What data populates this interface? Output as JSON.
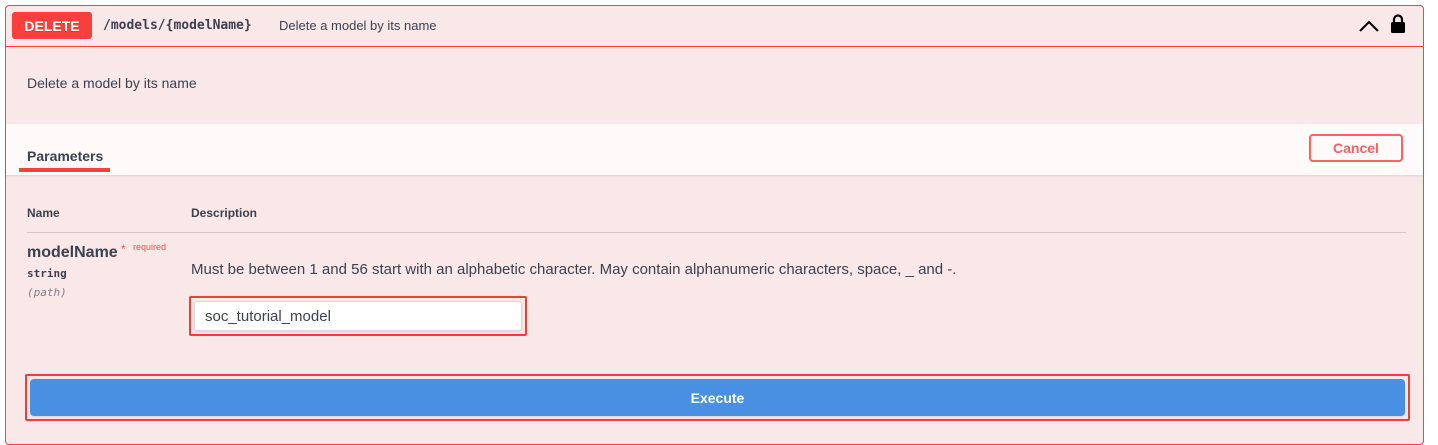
{
  "summary": {
    "method": "DELETE",
    "path": "/models/{modelName}",
    "description": "Delete a model by its name"
  },
  "description": "Delete a model by its name",
  "tabs": {
    "parameters": "Parameters"
  },
  "buttons": {
    "cancel": "Cancel",
    "execute": "Execute"
  },
  "table": {
    "headers": [
      "Name",
      "Description"
    ],
    "rows": [
      {
        "name": "modelName",
        "required_star": "*",
        "required_label": "required",
        "type": "string",
        "in": "(path)",
        "description": "Must be between 1 and 56 start with an alphabetic character. May contain alphanumeric characters, space, _ and -.",
        "value": "soc_tutorial_model"
      }
    ]
  },
  "icons": {
    "collapse": "chevron-up-icon",
    "auth": "lock-icon"
  },
  "colors": {
    "delete": "#f93e3e",
    "block_bg": "#fae7e7",
    "execute": "#4990e2",
    "highlight": "#e8413c"
  }
}
